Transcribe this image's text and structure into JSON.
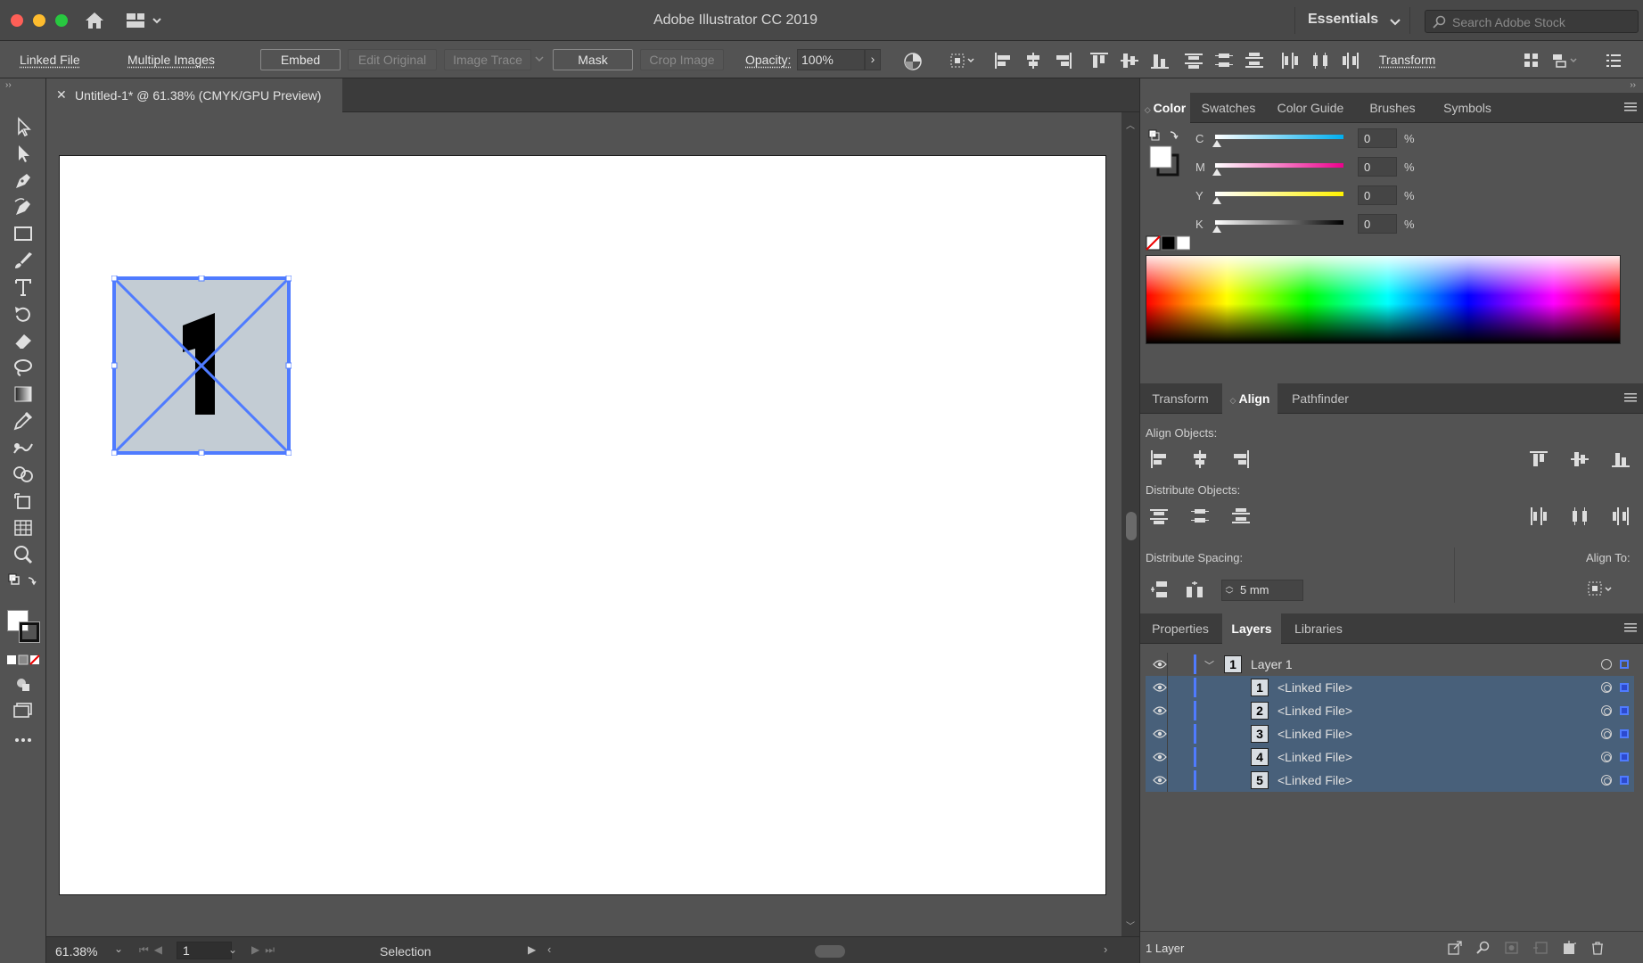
{
  "window": {
    "title": "Adobe Illustrator CC 2019",
    "workspace": "Essentials",
    "search_placeholder": "Search Adobe Stock"
  },
  "control_bar": {
    "linked_file": "Linked File",
    "multiple_images": "Multiple Images",
    "embed": "Embed",
    "edit_original": "Edit Original",
    "image_trace": "Image Trace",
    "mask": "Mask",
    "crop_image": "Crop Image",
    "opacity_label": "Opacity:",
    "opacity_value": "100%",
    "transform": "Transform"
  },
  "document": {
    "tab_title": "Untitled-1* @ 61.38% (CMYK/GPU Preview)",
    "placed_number": "1"
  },
  "status_bar": {
    "zoom": "61.38%",
    "artboard": "1",
    "tool": "Selection"
  },
  "color_panel": {
    "tabs": [
      "Color",
      "Swatches",
      "Color Guide",
      "Brushes",
      "Symbols"
    ],
    "active_tab": "Color",
    "channels": [
      {
        "label": "C",
        "value": "0",
        "unit": "%",
        "color": "#00aeef"
      },
      {
        "label": "M",
        "value": "0",
        "unit": "%",
        "color": "#ec008c"
      },
      {
        "label": "Y",
        "value": "0",
        "unit": "%",
        "color": "#fff200"
      },
      {
        "label": "K",
        "value": "0",
        "unit": "%",
        "color": "#000000"
      }
    ]
  },
  "align_panel": {
    "tabs": [
      "Transform",
      "Align",
      "Pathfinder"
    ],
    "active_tab": "Align",
    "align_objects_label": "Align Objects:",
    "distribute_objects_label": "Distribute Objects:",
    "distribute_spacing_label": "Distribute Spacing:",
    "align_to_label": "Align To:",
    "spacing_value": "5 mm"
  },
  "layers_panel": {
    "tabs": [
      "Properties",
      "Layers",
      "Libraries"
    ],
    "active_tab": "Layers",
    "layer_name": "Layer 1",
    "layer_thumb": "1",
    "items": [
      {
        "thumb": "1",
        "name": "<Linked File>"
      },
      {
        "thumb": "2",
        "name": "<Linked File>"
      },
      {
        "thumb": "3",
        "name": "<Linked File>"
      },
      {
        "thumb": "4",
        "name": "<Linked File>"
      },
      {
        "thumb": "5",
        "name": "<Linked File>"
      }
    ],
    "footer_count": "1 Layer"
  },
  "colors": {
    "selection": "#4f7bff",
    "placed_fill": "#c3ccd4",
    "selected_row": "#48607a"
  }
}
